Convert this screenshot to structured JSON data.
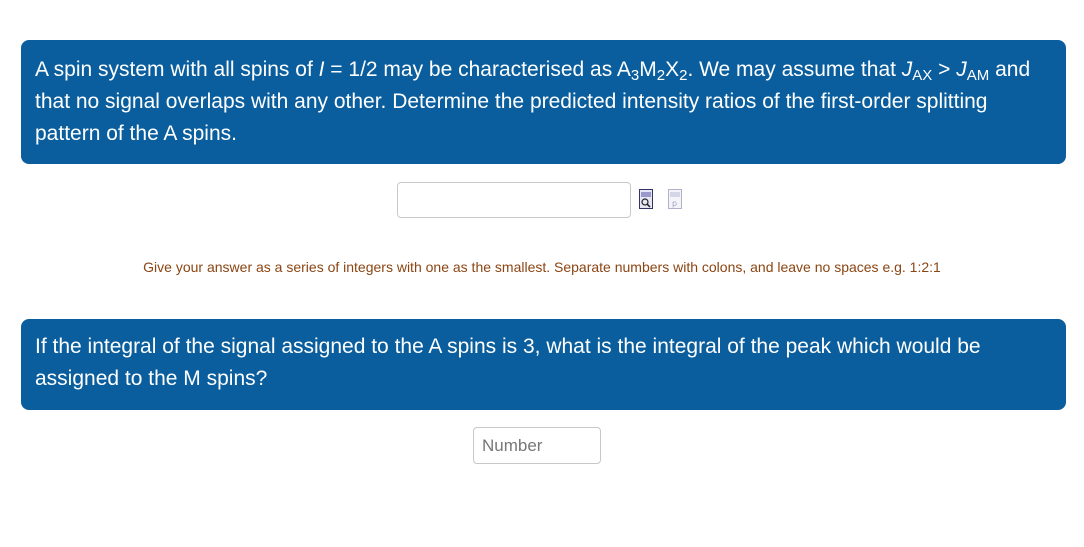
{
  "question1": {
    "text_a": "A spin system with all spins of ",
    "var_i": "I",
    "text_b": " = 1/2 may be characterised as A",
    "sub_a": "3",
    "text_c": "M",
    "sub_m": "2",
    "text_d": "X",
    "sub_x": "2",
    "text_e": ". We may assume that ",
    "var_j1": "J",
    "sub_j1": "AX",
    "text_f": " > ",
    "var_j2": "J",
    "sub_j2": "AM",
    "text_g": " and that no signal overlaps with any other. Determine the predicted intensity ratios of the first-order splitting pattern of the A spins."
  },
  "answer1": {
    "value": ""
  },
  "icons": {
    "preview": "preview-icon",
    "help": "help-icon"
  },
  "hint": "Give your answer as a series of integers with one as the smallest. Separate numbers with colons, and leave no spaces e.g. 1:2:1",
  "question2": {
    "text": "If the integral of the signal assigned to the A spins is 3, what is the integral of the peak which would be assigned to the M spins?"
  },
  "answer2": {
    "placeholder": "Number",
    "value": ""
  },
  "colors": {
    "accent": "#0a5e9e",
    "hint": "#8b4513"
  }
}
